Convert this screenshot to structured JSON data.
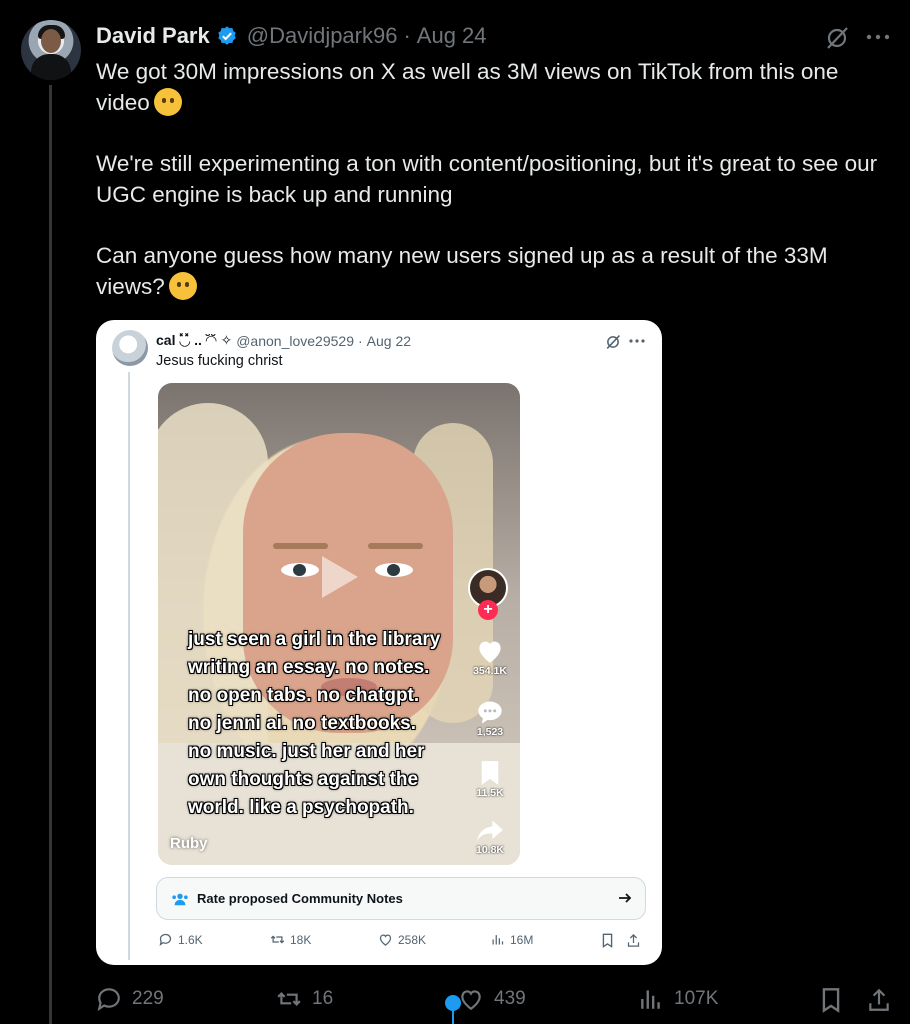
{
  "tweet": {
    "author_name": "David Park",
    "handle": "@Davidjpark96",
    "separator": "·",
    "date": "Aug 24",
    "paragraphs": [
      "We got 30M impressions on X as well as 3M views on TikTok from this one video",
      "We're still experimenting a ton with content/positioning, but it's great to see our UGC engine is back up and running",
      "Can anyone guess how many new users signed up as a result of the 33M views?"
    ],
    "emoji_icons": [
      "saluting-face-emoji-icon",
      "thinking-face-emoji-icon"
    ]
  },
  "quote": {
    "author_name": "cal ◟̽◞̽ .. ◜̆◝̆ ✧",
    "handle": "@anon_love29529",
    "separator": "·",
    "date": "Aug 22",
    "text": "Jesus fucking christ",
    "video": {
      "caption_lines": [
        "just seen a girl in the library",
        "writing an essay. no notes.",
        "no open tabs. no chatgpt.",
        "no jenni ai. no textbooks.",
        "no music. just her and her",
        "own thoughts against the",
        "world. like a psychopath."
      ],
      "likes": "354.1K",
      "comments": "1,523",
      "saves": "11.5K",
      "shares": "10.8K",
      "creator": "Ruby"
    },
    "community_notes_label": "Rate proposed Community Notes",
    "stats": {
      "replies": "1.6K",
      "reposts": "18K",
      "likes": "258K",
      "views": "16M"
    }
  },
  "stats": {
    "replies": "229",
    "reposts": "16",
    "likes": "439",
    "views": "107K"
  },
  "colors": {
    "background": "#000000",
    "text": "#e7e9ea",
    "muted": "#71767b",
    "verified": "#1d9bf0",
    "tiktok_plus": "#fe2c55"
  }
}
